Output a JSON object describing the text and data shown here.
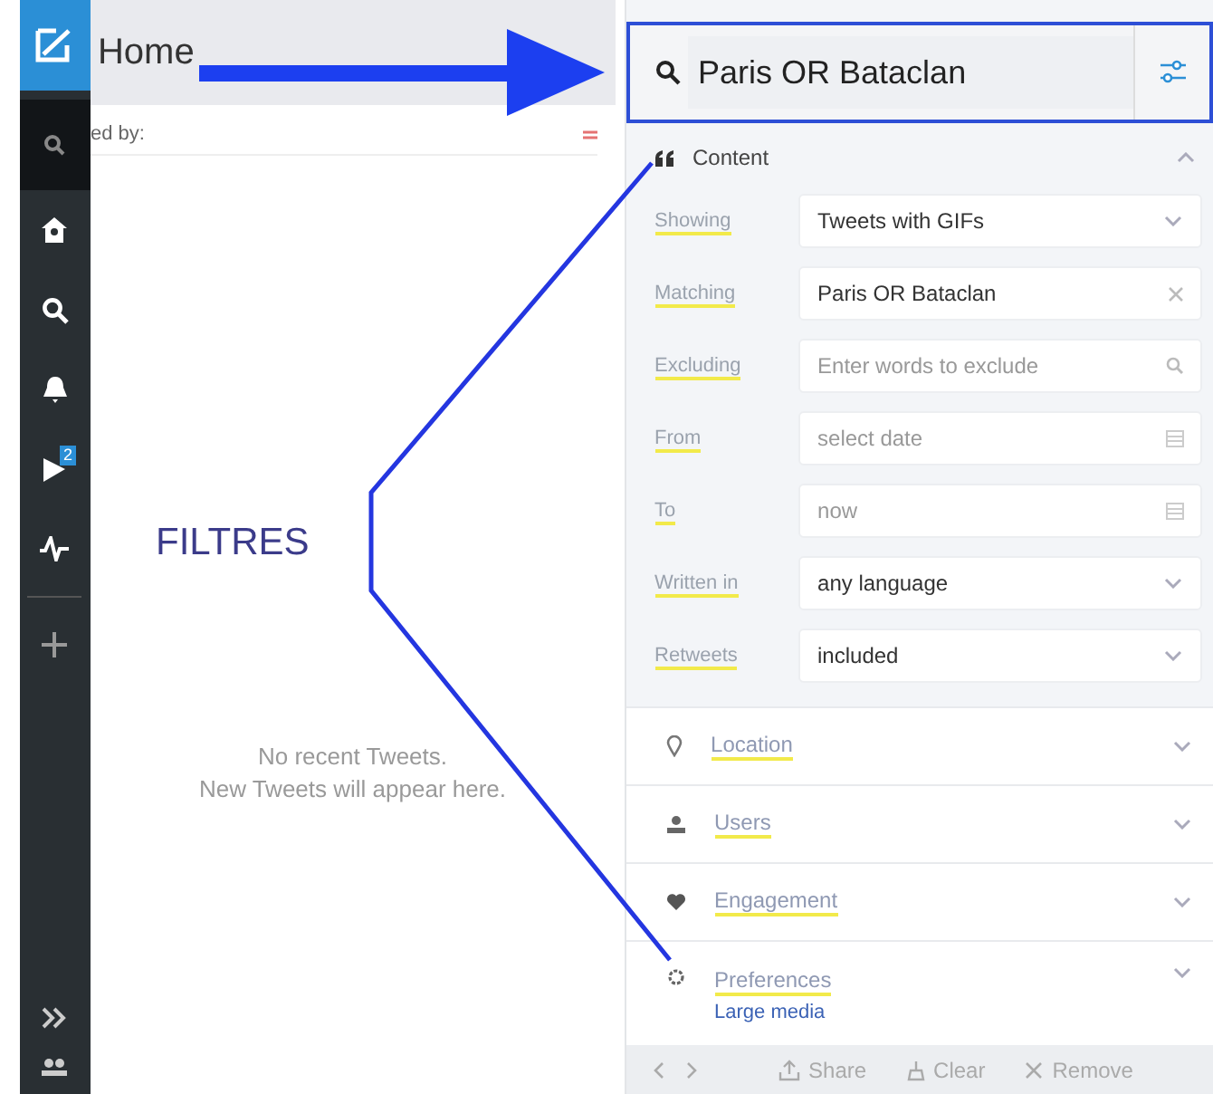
{
  "sidebar": {
    "badge": "2"
  },
  "column": {
    "title": "Home",
    "filter_label": "ed by:",
    "empty_lines": [
      "No recent Tweets.",
      "New Tweets will appear here."
    ]
  },
  "search": {
    "value": "Paris OR Bataclan"
  },
  "content": {
    "title": "Content",
    "expanded": true,
    "fields": [
      {
        "label": "Showing",
        "kind": "dropdown",
        "value": "Tweets with GIFs"
      },
      {
        "label": "Matching",
        "kind": "clear",
        "value": "Paris OR Bataclan"
      },
      {
        "label": "Excluding",
        "kind": "search",
        "placeholder": "Enter words to exclude"
      },
      {
        "label": "From",
        "kind": "date",
        "placeholder": "select date"
      },
      {
        "label": "To",
        "kind": "date",
        "placeholder": "now"
      },
      {
        "label": "Written in",
        "kind": "dropdown",
        "value": "any language"
      },
      {
        "label": "Retweets",
        "kind": "dropdown",
        "value": "included"
      }
    ]
  },
  "sections": [
    {
      "title": "Location",
      "kind": "pin",
      "expanded": false
    },
    {
      "title": "Users",
      "kind": "user",
      "expanded": false
    },
    {
      "title": "Engagement",
      "kind": "heart",
      "expanded": false
    },
    {
      "title": "Preferences",
      "kind": "gear",
      "expanded": false,
      "subtitle": "Large media"
    }
  ],
  "footer": [
    {
      "label": "Share",
      "kind": "share"
    },
    {
      "label": "Clear",
      "kind": "clear"
    },
    {
      "label": "Remove",
      "kind": "remove"
    }
  ],
  "annotation": {
    "label": "FILTRES"
  }
}
